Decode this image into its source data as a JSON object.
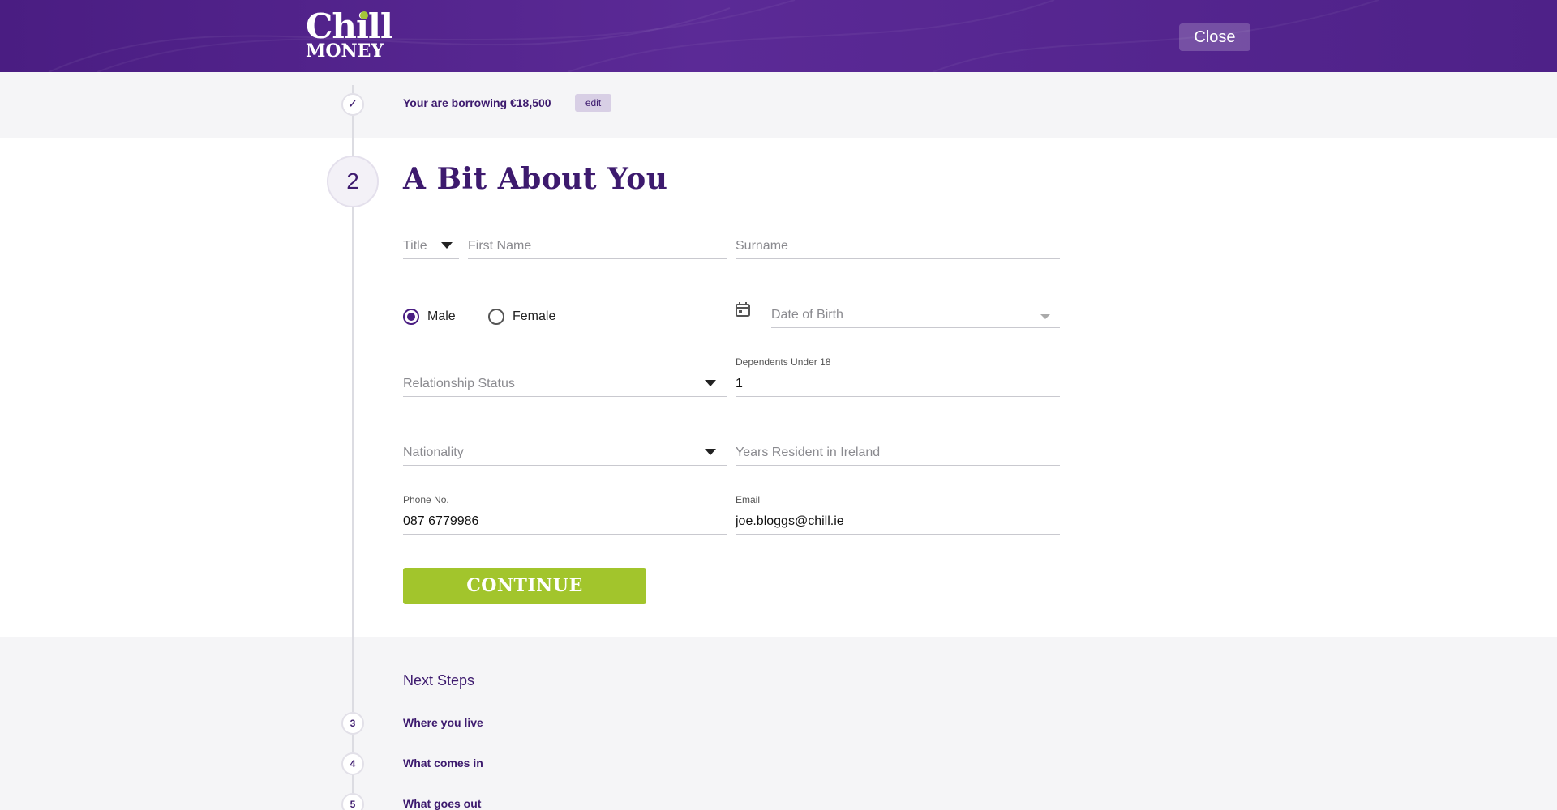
{
  "header": {
    "logo_line1": "Chill",
    "logo_line2": "MONEY",
    "close_label": "Close"
  },
  "summary": {
    "text": "Your are borrowing €18,500",
    "edit_label": "edit",
    "done_icon": "check-icon"
  },
  "section": {
    "step_number": "2",
    "title": "A Bit About You"
  },
  "form": {
    "title_placeholder": "Title",
    "first_name_placeholder": "First Name",
    "surname_placeholder": "Surname",
    "gender_options": [
      "Male",
      "Female"
    ],
    "gender_selected": "Male",
    "dob_placeholder": "Date of Birth",
    "relationship_placeholder": "Relationship Status",
    "dependents_label": "Dependents Under 18",
    "dependents_value": "1",
    "nationality_placeholder": "Nationality",
    "years_resident_placeholder": "Years Resident in Ireland",
    "phone_label": "Phone No.",
    "phone_value": "087 6779986",
    "email_label": "Email",
    "email_value": "joe.bloggs@chill.ie",
    "continue_label": "CONTINUE"
  },
  "next_steps": {
    "title": "Next Steps",
    "items": [
      {
        "number": "3",
        "label": "Where you live"
      },
      {
        "number": "4",
        "label": "What comes in"
      },
      {
        "number": "5",
        "label": "What goes out"
      }
    ]
  },
  "colors": {
    "brand_purple": "#4a1d82",
    "accent_green": "#a2c52c",
    "text_purple": "#3d1a6e"
  }
}
